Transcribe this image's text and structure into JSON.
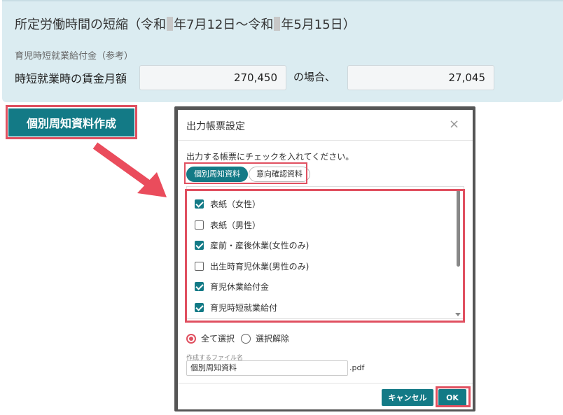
{
  "info_panel": {
    "title_part1": "所定労働時間の短縮（令和",
    "title_part2": "年7月12日～令和",
    "title_part3": "年5月15日）",
    "subtitle": "育児時短就業給付金（参考）",
    "wage_label": "時短就業時の賃金月額",
    "wage_value": "270,450",
    "case_label": "の場合、",
    "benefit_value": "27,045"
  },
  "main_button": {
    "label": "個別周知資料作成"
  },
  "modal": {
    "title": "出力帳票設定",
    "close_symbol": "×",
    "instruction": "出力する帳票にチェックを入れてください。",
    "tabs": [
      {
        "label": "個別周知資料",
        "active": true
      },
      {
        "label": "意向確認資料",
        "active": false
      }
    ],
    "items": [
      {
        "label": "表紙（女性）",
        "checked": true
      },
      {
        "label": "表紙（男性）",
        "checked": false
      },
      {
        "label": "産前・産後休業(女性のみ)",
        "checked": true
      },
      {
        "label": "出生時育児休業(男性のみ)",
        "checked": false
      },
      {
        "label": "育児休業給付金",
        "checked": true
      },
      {
        "label": "育児時短就業給付",
        "checked": true
      }
    ],
    "select_all_label": "全て選択",
    "deselect_label": "選択解除",
    "file_name_label": "作成するファイル名",
    "file_name_value": "個別周知資料",
    "file_ext": ".pdf",
    "cancel_label": "キャンセル",
    "ok_label": "OK"
  },
  "colors": {
    "accent": "#137a86",
    "highlight": "#e05060",
    "panel_bg": "#dbecf1"
  }
}
